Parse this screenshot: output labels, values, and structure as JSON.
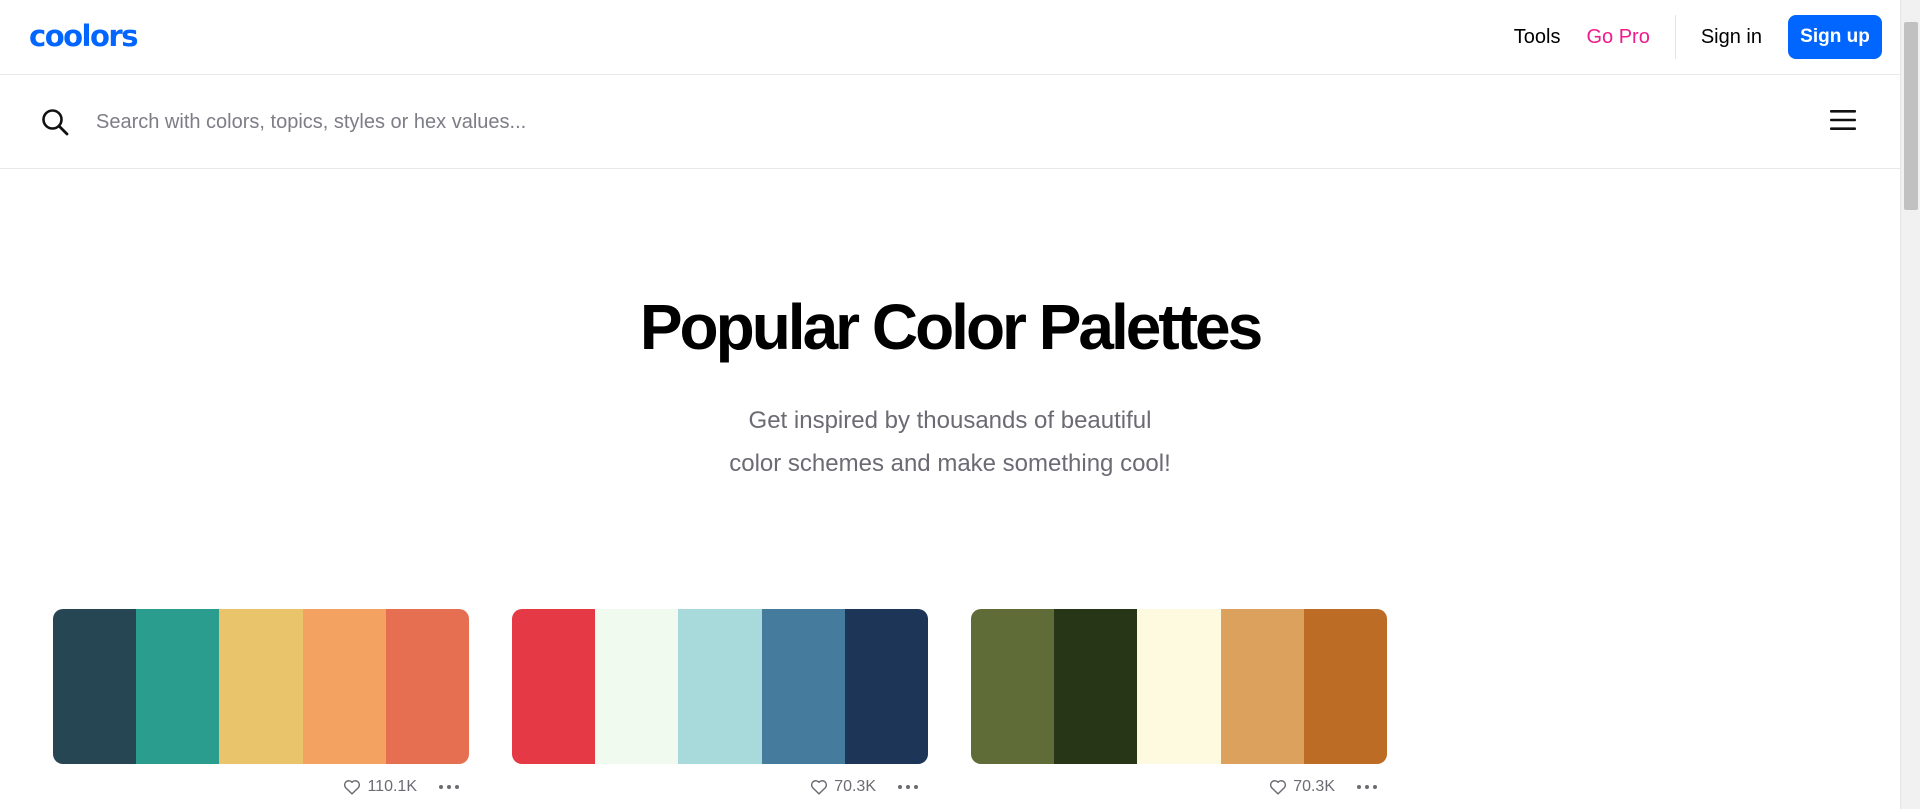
{
  "header": {
    "logo": "coolors",
    "nav": {
      "tools": "Tools",
      "go_pro": "Go Pro",
      "sign_in": "Sign in",
      "sign_up": "Sign up"
    }
  },
  "search": {
    "placeholder": "Search with colors, topics, styles or hex values..."
  },
  "hero": {
    "title": "Popular Color Palettes",
    "subtitle_line1": "Get inspired by thousands of beautiful",
    "subtitle_line2": "color schemes and make something cool!"
  },
  "palettes": [
    {
      "colors": [
        "#264653",
        "#2a9d8f",
        "#e9c46a",
        "#f4a261",
        "#e76f51"
      ],
      "likes": "110.1K"
    },
    {
      "colors": [
        "#e63946",
        "#f1faee",
        "#a8dadc",
        "#457b9d",
        "#1d3557"
      ],
      "likes": "70.3K"
    },
    {
      "colors": [
        "#606c38",
        "#283618",
        "#fefae0",
        "#dda15e",
        "#bc6c25"
      ],
      "likes": "70.3K"
    }
  ],
  "theme": {
    "accent": "#0066ff",
    "pro": "#ee1b8e",
    "muted": "#6b6b73"
  },
  "icons": [
    "search-icon",
    "menu-icon",
    "heart-icon",
    "more-icon"
  ]
}
